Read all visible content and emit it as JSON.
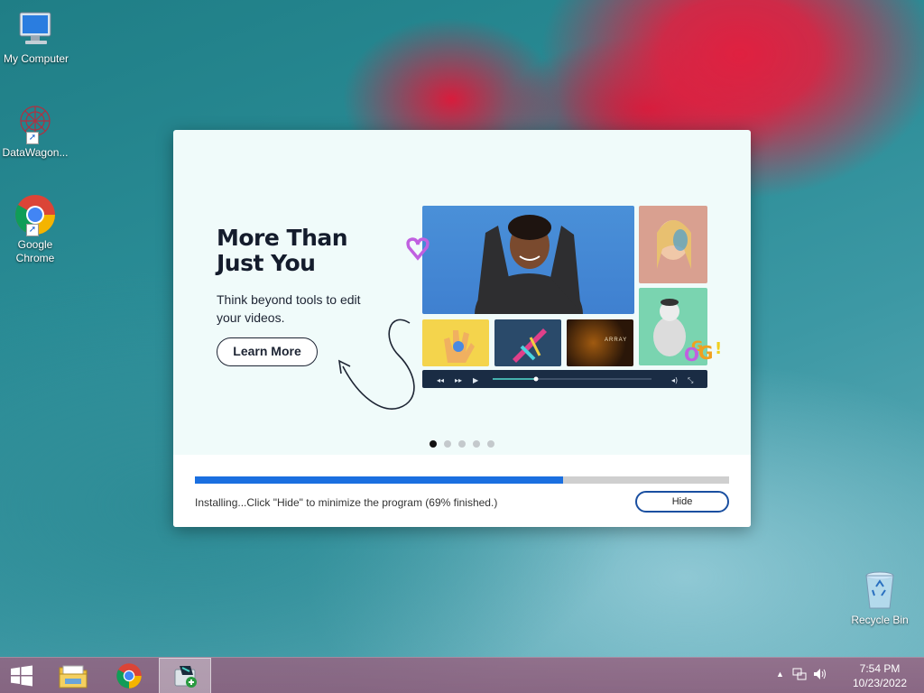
{
  "desktop": {
    "icons": [
      {
        "label": "My Computer",
        "icon": "computer-icon"
      },
      {
        "label": "DataWagon...",
        "icon": "datawagon-icon"
      },
      {
        "label": "Google Chrome",
        "icon": "chrome-icon"
      },
      {
        "label": "Recycle Bin",
        "icon": "recycle-bin-icon"
      }
    ]
  },
  "installer": {
    "hero_title": "More Than Just You",
    "hero_subtitle": "Think beyond tools to edit your videos.",
    "learn_more": "Learn More",
    "collage_text": "ARRAY",
    "slide_count": 5,
    "active_slide": 1,
    "progress_percent": 69,
    "status": "Installing...Click \"Hide\" to minimize the program (69% finished.)",
    "hide_label": "Hide"
  },
  "taskbar": {
    "items": [
      "start-button",
      "file-explorer",
      "google-chrome",
      "filmora-installer"
    ],
    "time": "7:54 PM",
    "date": "10/23/2022"
  },
  "colors": {
    "accent": "#1a6fe0",
    "progress_track": "#cfcfcf",
    "dialog_bg": "#f0fbfa"
  }
}
